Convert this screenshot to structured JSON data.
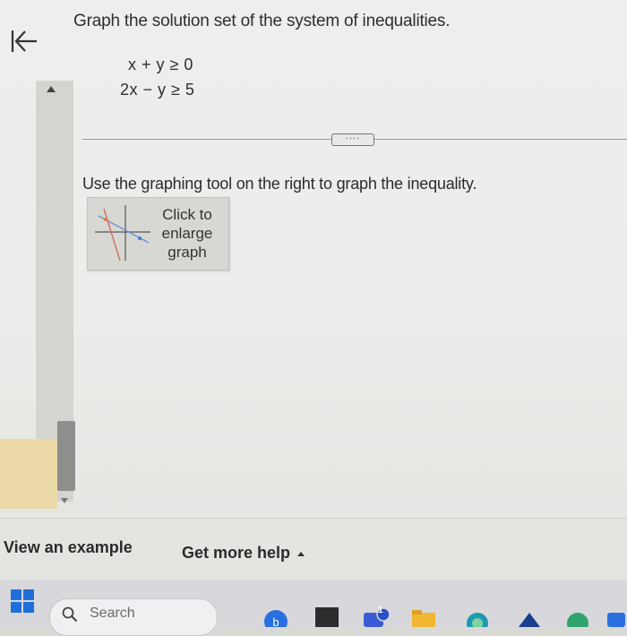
{
  "question": {
    "prompt": "Graph the solution set of the system of inequalities.",
    "inequalities": [
      "x + y ≥ 0",
      "2x − y ≥ 5"
    ]
  },
  "divider": {
    "more_label": "····"
  },
  "instruction": "Use the graphing tool on the right to graph the inequality.",
  "graph_button": {
    "lines": [
      "Click to",
      "enlarge",
      "graph"
    ]
  },
  "footer": {
    "view_example": "View an example",
    "get_more_help": "Get more help"
  },
  "taskbar": {
    "search_label": "Search",
    "notification_badge": "1"
  },
  "colors": {
    "page_background": "#eeeeec",
    "footer_background": "#e4e4e1",
    "taskbar_background": "#d8d8dc",
    "windows_blue": "#1e6fd9"
  },
  "icons": [
    "back-arrow-icon",
    "windows-start-icon",
    "search-icon",
    "bing-icon",
    "chat-icon",
    "folder-icon",
    "browser-icon"
  ]
}
